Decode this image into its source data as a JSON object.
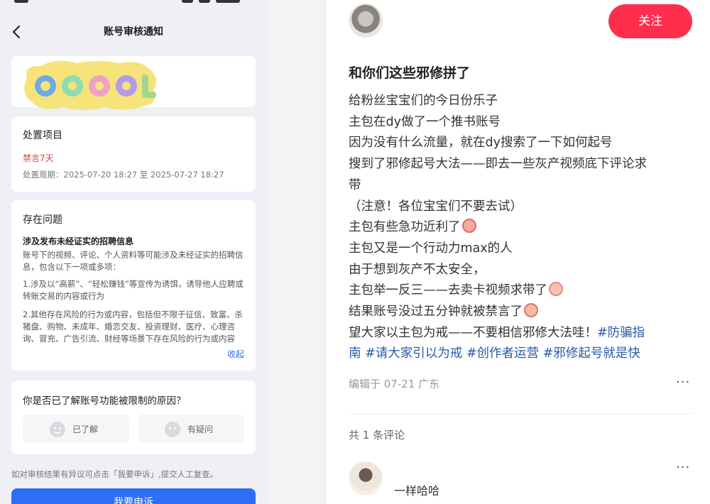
{
  "left": {
    "nav_title": "账号审核通知",
    "banner_text": "COOL",
    "action": {
      "heading": "处置项目",
      "penalty": "禁言7天",
      "period": "处置周期：2025-07-20 18:27 至 2025-07-27 18:27"
    },
    "issue": {
      "heading": "存在问题",
      "subheading": "涉及发布未经证实的招聘信息",
      "para1": "账号下的视频、评论、个人资料等可能涉及未经证实的招聘信息，包含以下一项或多项：",
      "para2": "1.涉及以“高薪”、“轻松赚钱”等宣传为诱饵，诱导他人应聘或转账交易的内容或行为",
      "para3": "2.其他存在风险的行为或内容，包括但不限于征信、致富、杀猪盘、购物、未成年、婚恋交友、投资理财、医疗、心理咨询、冒充、广告引流、财经等场景下存在风险的行为或内容",
      "collapse": "收起"
    },
    "question": {
      "title": "你是否已了解账号功能被限制的原因？",
      "option_understood": "已了解",
      "option_doubt": "有疑问"
    },
    "appeal_note": "如对审核结果有异议可点击「我要申诉」,提交人工复查。",
    "appeal_button": "我要申诉"
  },
  "right": {
    "follow_button": "关注",
    "title": "和你们这些邪修拼了",
    "lines": [
      "给粉丝宝宝们的今日份乐子",
      "主包在dy做了一个推书账号",
      "因为没有什么流量，就在dy搜索了一下如何起号",
      "搜到了邪修起号大法——即去一些灰产视频底下评论求",
      "带",
      "（注意！各位宝宝们不要去试）",
      "主包有些急功近利了",
      "主包又是一个行动力max的人",
      "由于想到灰产不太安全，",
      "主包举一反三——去卖卡视频求带了",
      "结果账号没过五分钟就被禁言了",
      "望大家以主包为戒——不要相信邪修大法哇！"
    ],
    "tags": [
      "#防骗指",
      "南",
      "#请大家引以为戒",
      "#创作者运营",
      "#邪修起号就是快"
    ],
    "meta": "编辑于 07-21 广东",
    "comment_count": "共 1 条评论",
    "comment_text": "一样哈哈",
    "more": "···"
  },
  "colors": {
    "follow_red": "#ff2e4d",
    "tag_blue": "#2a5aa6",
    "appeal_blue": "#2e6ef5",
    "penalty_red": "#e23c3c"
  },
  "icons": [
    "back-arrow-icon",
    "smile-face-icon",
    "confused-face-icon",
    "more-dots-icon",
    "emoji-icon"
  ]
}
